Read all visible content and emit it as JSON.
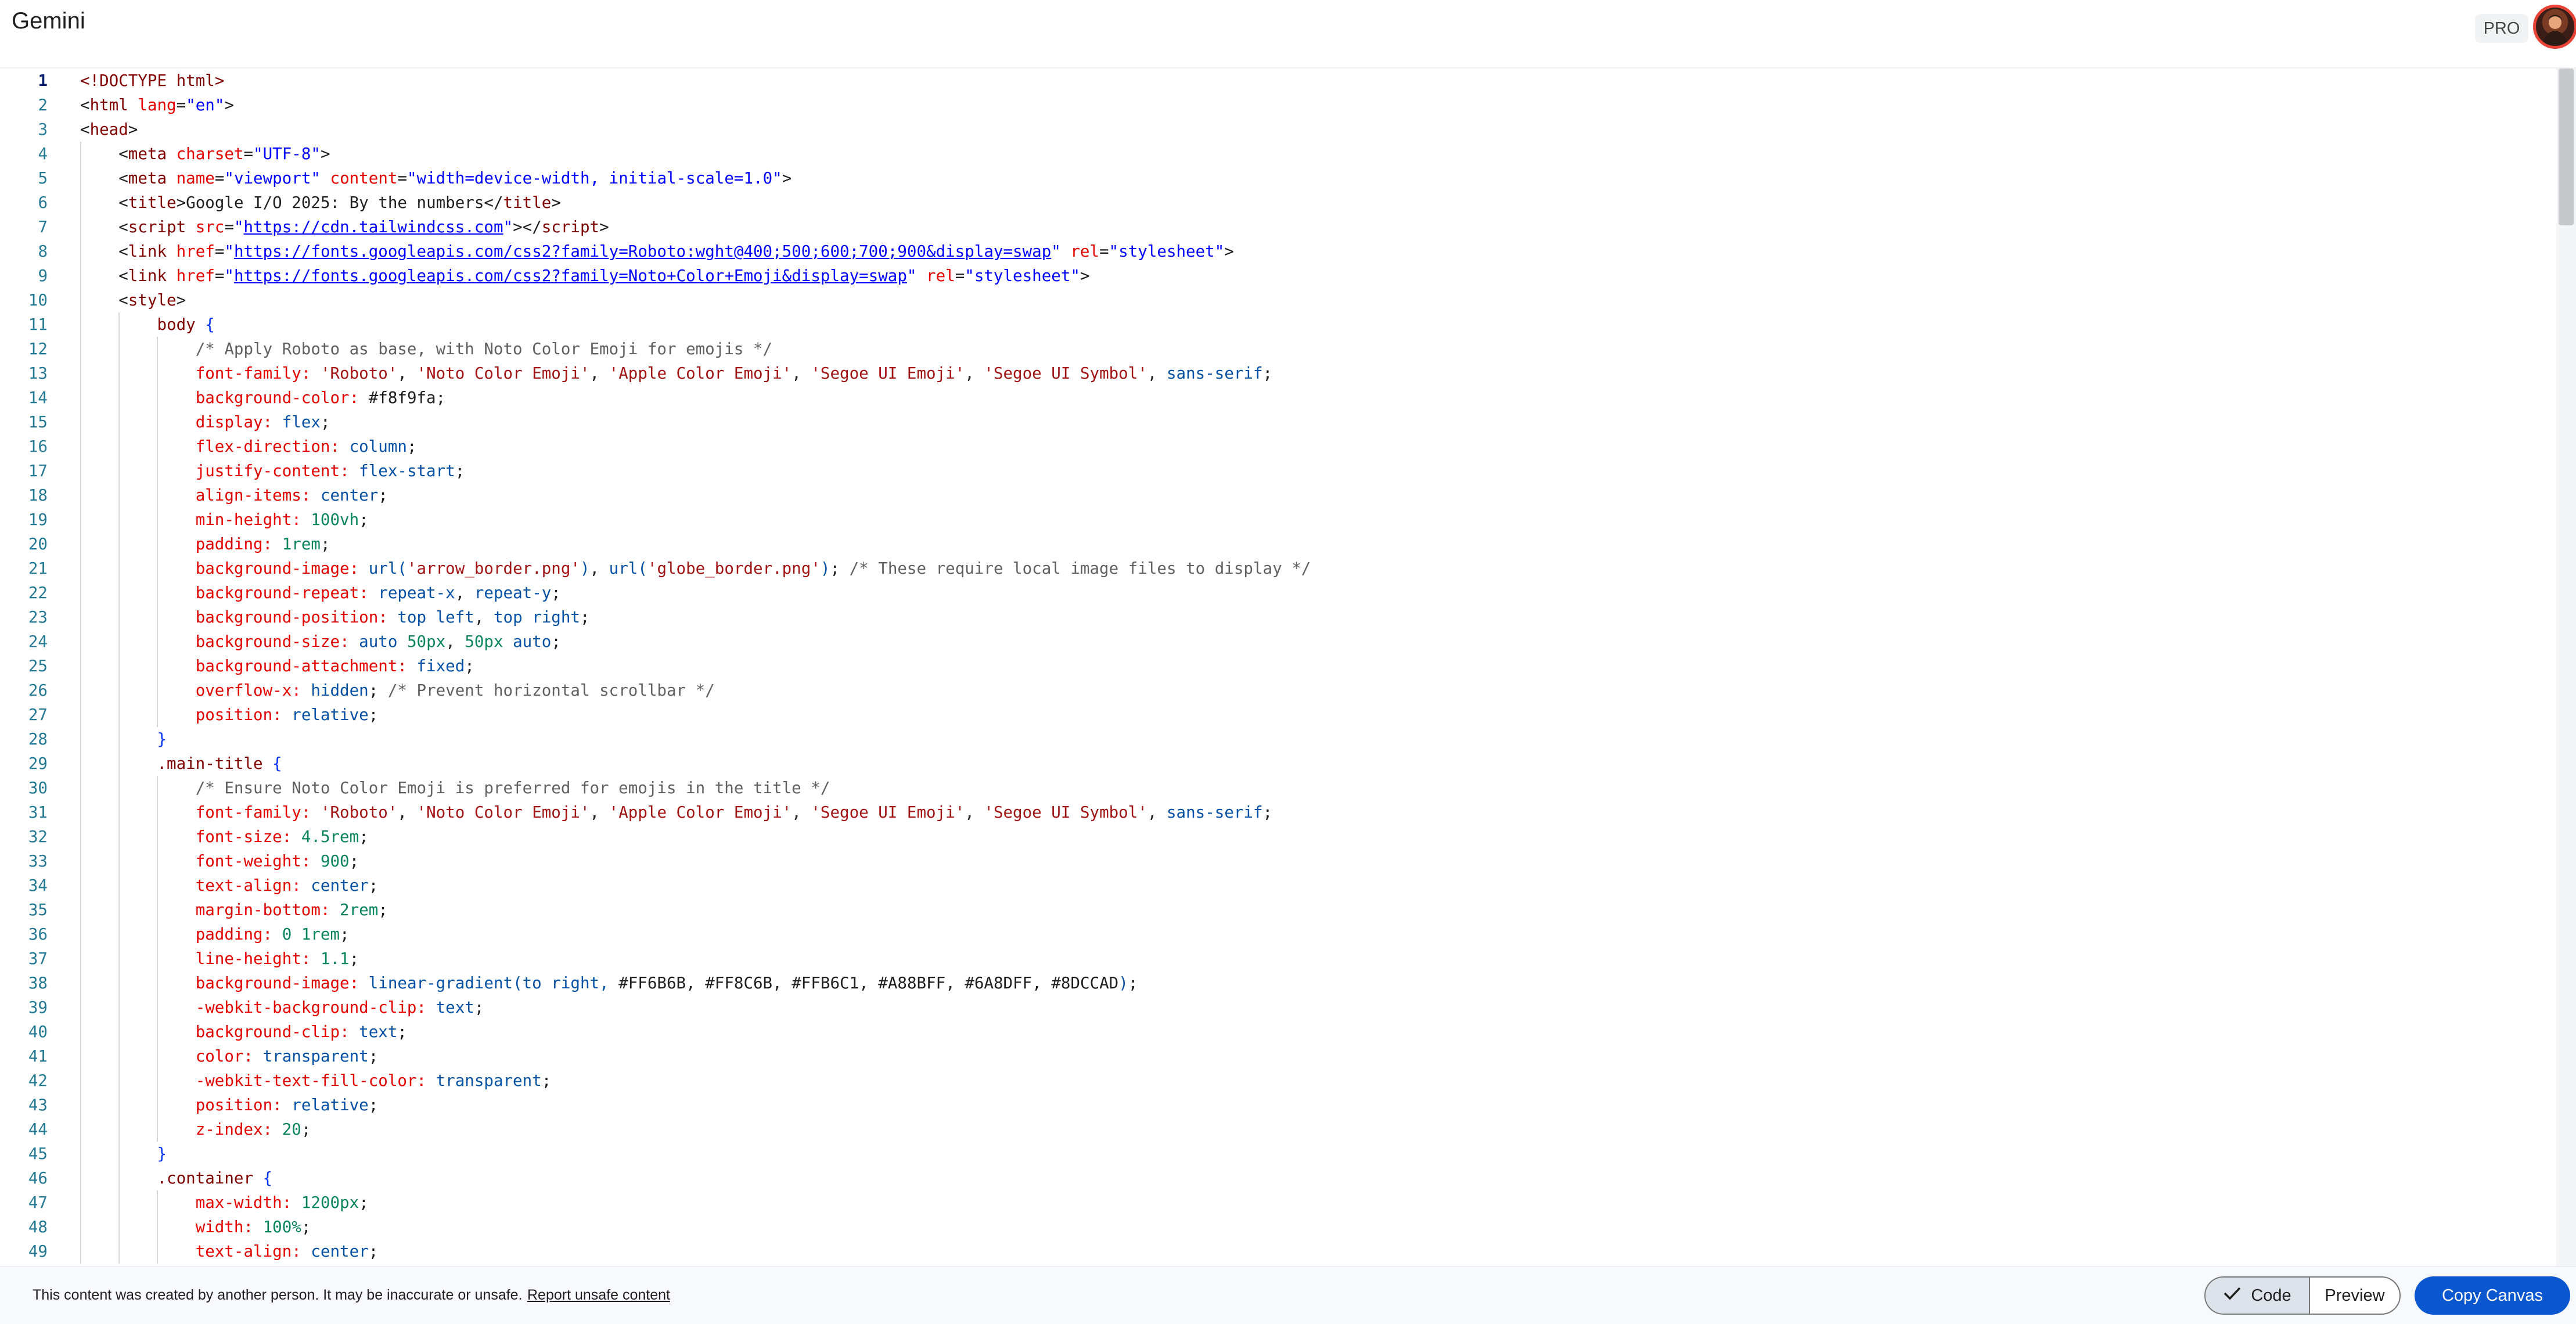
{
  "header": {
    "app_title": "Gemini",
    "pro_badge": "PRO",
    "avatar_alt": "user-avatar"
  },
  "editor": {
    "active_line": 1,
    "lines": [
      [
        [
          "dtd",
          "<!DOCTYPE "
        ],
        [
          "tag",
          "html"
        ],
        [
          "dtd",
          ">"
        ]
      ],
      [
        [
          "punc",
          "<"
        ],
        [
          "tag",
          "html"
        ],
        [
          "plain",
          " "
        ],
        [
          "attr",
          "lang"
        ],
        [
          "punc",
          "="
        ],
        [
          "str",
          "\"en\""
        ],
        [
          "punc",
          ">"
        ]
      ],
      [
        [
          "punc",
          "<"
        ],
        [
          "tag",
          "head"
        ],
        [
          "punc",
          ">"
        ]
      ],
      [
        [
          "plain",
          "    "
        ],
        [
          "punc",
          "<"
        ],
        [
          "tag",
          "meta"
        ],
        [
          "plain",
          " "
        ],
        [
          "attr",
          "charset"
        ],
        [
          "punc",
          "="
        ],
        [
          "str",
          "\"UTF-8\""
        ],
        [
          "punc",
          ">"
        ]
      ],
      [
        [
          "plain",
          "    "
        ],
        [
          "punc",
          "<"
        ],
        [
          "tag",
          "meta"
        ],
        [
          "plain",
          " "
        ],
        [
          "attr",
          "name"
        ],
        [
          "punc",
          "="
        ],
        [
          "str",
          "\"viewport\""
        ],
        [
          "plain",
          " "
        ],
        [
          "attr",
          "content"
        ],
        [
          "punc",
          "="
        ],
        [
          "str",
          "\"width=device-width, initial-scale=1.0\""
        ],
        [
          "punc",
          ">"
        ]
      ],
      [
        [
          "plain",
          "    "
        ],
        [
          "punc",
          "<"
        ],
        [
          "tag",
          "title"
        ],
        [
          "punc",
          ">"
        ],
        [
          "plain",
          "Google I/O 2025: By the numbers"
        ],
        [
          "punc",
          "</"
        ],
        [
          "tag",
          "title"
        ],
        [
          "punc",
          ">"
        ]
      ],
      [
        [
          "plain",
          "    "
        ],
        [
          "punc",
          "<"
        ],
        [
          "tag",
          "script"
        ],
        [
          "plain",
          " "
        ],
        [
          "attr",
          "src"
        ],
        [
          "punc",
          "="
        ],
        [
          "str",
          "\""
        ],
        [
          "link",
          "https://cdn.tailwindcss.com"
        ],
        [
          "str",
          "\""
        ],
        [
          "punc",
          "></"
        ],
        [
          "tag",
          "script"
        ],
        [
          "punc",
          ">"
        ]
      ],
      [
        [
          "plain",
          "    "
        ],
        [
          "punc",
          "<"
        ],
        [
          "tag",
          "link"
        ],
        [
          "plain",
          " "
        ],
        [
          "attr",
          "href"
        ],
        [
          "punc",
          "="
        ],
        [
          "str",
          "\""
        ],
        [
          "link",
          "https://fonts.googleapis.com/css2?family=Roboto:wght@400;500;600;700;900&display=swap"
        ],
        [
          "str",
          "\""
        ],
        [
          "plain",
          " "
        ],
        [
          "attr",
          "rel"
        ],
        [
          "punc",
          "="
        ],
        [
          "str",
          "\"stylesheet\""
        ],
        [
          "punc",
          ">"
        ]
      ],
      [
        [
          "plain",
          "    "
        ],
        [
          "punc",
          "<"
        ],
        [
          "tag",
          "link"
        ],
        [
          "plain",
          " "
        ],
        [
          "attr",
          "href"
        ],
        [
          "punc",
          "="
        ],
        [
          "str",
          "\""
        ],
        [
          "link",
          "https://fonts.googleapis.com/css2?family=Noto+Color+Emoji&display=swap"
        ],
        [
          "str",
          "\""
        ],
        [
          "plain",
          " "
        ],
        [
          "attr",
          "rel"
        ],
        [
          "punc",
          "="
        ],
        [
          "str",
          "\"stylesheet\""
        ],
        [
          "punc",
          ">"
        ]
      ],
      [
        [
          "plain",
          "    "
        ],
        [
          "punc",
          "<"
        ],
        [
          "tag",
          "style"
        ],
        [
          "punc",
          ">"
        ]
      ],
      [
        [
          "plain",
          "        "
        ],
        [
          "sel",
          "body"
        ],
        [
          "plain",
          " "
        ],
        [
          "brace",
          "{"
        ]
      ],
      [
        [
          "plain",
          "            "
        ],
        [
          "cmt",
          "/* Apply Roboto as base, with Noto Color Emoji for emojis */"
        ]
      ],
      [
        [
          "plain",
          "            "
        ],
        [
          "prop",
          "font-family:"
        ],
        [
          "plain",
          " "
        ],
        [
          "cstr",
          "'Roboto'"
        ],
        [
          "plain",
          ", "
        ],
        [
          "cstr",
          "'Noto Color Emoji'"
        ],
        [
          "plain",
          ", "
        ],
        [
          "cstr",
          "'Apple Color Emoji'"
        ],
        [
          "plain",
          ", "
        ],
        [
          "cstr",
          "'Segoe UI Emoji'"
        ],
        [
          "plain",
          ", "
        ],
        [
          "cstr",
          "'Segoe UI Symbol'"
        ],
        [
          "plain",
          ", "
        ],
        [
          "val",
          "sans-serif"
        ],
        [
          "plain",
          ";"
        ]
      ],
      [
        [
          "plain",
          "            "
        ],
        [
          "prop",
          "background-color:"
        ],
        [
          "plain",
          " "
        ],
        [
          "hex",
          "#f8f9fa"
        ],
        [
          "plain",
          ";"
        ]
      ],
      [
        [
          "plain",
          "            "
        ],
        [
          "prop",
          "display:"
        ],
        [
          "plain",
          " "
        ],
        [
          "val",
          "flex"
        ],
        [
          "plain",
          ";"
        ]
      ],
      [
        [
          "plain",
          "            "
        ],
        [
          "prop",
          "flex-direction:"
        ],
        [
          "plain",
          " "
        ],
        [
          "val",
          "column"
        ],
        [
          "plain",
          ";"
        ]
      ],
      [
        [
          "plain",
          "            "
        ],
        [
          "prop",
          "justify-content:"
        ],
        [
          "plain",
          " "
        ],
        [
          "val",
          "flex-start"
        ],
        [
          "plain",
          ";"
        ]
      ],
      [
        [
          "plain",
          "            "
        ],
        [
          "prop",
          "align-items:"
        ],
        [
          "plain",
          " "
        ],
        [
          "val",
          "center"
        ],
        [
          "plain",
          ";"
        ]
      ],
      [
        [
          "plain",
          "            "
        ],
        [
          "prop",
          "min-height:"
        ],
        [
          "plain",
          " "
        ],
        [
          "num",
          "100vh"
        ],
        [
          "plain",
          ";"
        ]
      ],
      [
        [
          "plain",
          "            "
        ],
        [
          "prop",
          "padding:"
        ],
        [
          "plain",
          " "
        ],
        [
          "num",
          "1rem"
        ],
        [
          "plain",
          ";"
        ]
      ],
      [
        [
          "plain",
          "            "
        ],
        [
          "prop",
          "background-image:"
        ],
        [
          "plain",
          " "
        ],
        [
          "val",
          "url("
        ],
        [
          "cstr",
          "'arrow_border.png'"
        ],
        [
          "val",
          ")"
        ],
        [
          "plain",
          ", "
        ],
        [
          "val",
          "url("
        ],
        [
          "cstr",
          "'globe_border.png'"
        ],
        [
          "val",
          ")"
        ],
        [
          "plain",
          "; "
        ],
        [
          "cmt",
          "/* These require local image files to display */"
        ]
      ],
      [
        [
          "plain",
          "            "
        ],
        [
          "prop",
          "background-repeat:"
        ],
        [
          "plain",
          " "
        ],
        [
          "val",
          "repeat-x"
        ],
        [
          "plain",
          ", "
        ],
        [
          "val",
          "repeat-y"
        ],
        [
          "plain",
          ";"
        ]
      ],
      [
        [
          "plain",
          "            "
        ],
        [
          "prop",
          "background-position:"
        ],
        [
          "plain",
          " "
        ],
        [
          "val",
          "top left"
        ],
        [
          "plain",
          ", "
        ],
        [
          "val",
          "top right"
        ],
        [
          "plain",
          ";"
        ]
      ],
      [
        [
          "plain",
          "            "
        ],
        [
          "prop",
          "background-size:"
        ],
        [
          "plain",
          " "
        ],
        [
          "val",
          "auto"
        ],
        [
          "plain",
          " "
        ],
        [
          "num",
          "50px"
        ],
        [
          "plain",
          ", "
        ],
        [
          "num",
          "50px"
        ],
        [
          "plain",
          " "
        ],
        [
          "val",
          "auto"
        ],
        [
          "plain",
          ";"
        ]
      ],
      [
        [
          "plain",
          "            "
        ],
        [
          "prop",
          "background-attachment:"
        ],
        [
          "plain",
          " "
        ],
        [
          "val",
          "fixed"
        ],
        [
          "plain",
          ";"
        ]
      ],
      [
        [
          "plain",
          "            "
        ],
        [
          "prop",
          "overflow-x:"
        ],
        [
          "plain",
          " "
        ],
        [
          "val",
          "hidden"
        ],
        [
          "plain",
          "; "
        ],
        [
          "cmt",
          "/* Prevent horizontal scrollbar */"
        ]
      ],
      [
        [
          "plain",
          "            "
        ],
        [
          "prop",
          "position:"
        ],
        [
          "plain",
          " "
        ],
        [
          "val",
          "relative"
        ],
        [
          "plain",
          ";"
        ]
      ],
      [
        [
          "plain",
          "        "
        ],
        [
          "brace",
          "}"
        ]
      ],
      [
        [
          "plain",
          "        "
        ],
        [
          "sel",
          ".main-title"
        ],
        [
          "plain",
          " "
        ],
        [
          "brace",
          "{"
        ]
      ],
      [
        [
          "plain",
          "            "
        ],
        [
          "cmt",
          "/* Ensure Noto Color Emoji is preferred for emojis in the title */"
        ]
      ],
      [
        [
          "plain",
          "            "
        ],
        [
          "prop",
          "font-family:"
        ],
        [
          "plain",
          " "
        ],
        [
          "cstr",
          "'Roboto'"
        ],
        [
          "plain",
          ", "
        ],
        [
          "cstr",
          "'Noto Color Emoji'"
        ],
        [
          "plain",
          ", "
        ],
        [
          "cstr",
          "'Apple Color Emoji'"
        ],
        [
          "plain",
          ", "
        ],
        [
          "cstr",
          "'Segoe UI Emoji'"
        ],
        [
          "plain",
          ", "
        ],
        [
          "cstr",
          "'Segoe UI Symbol'"
        ],
        [
          "plain",
          ", "
        ],
        [
          "val",
          "sans-serif"
        ],
        [
          "plain",
          ";"
        ]
      ],
      [
        [
          "plain",
          "            "
        ],
        [
          "prop",
          "font-size:"
        ],
        [
          "plain",
          " "
        ],
        [
          "num",
          "4.5rem"
        ],
        [
          "plain",
          ";"
        ]
      ],
      [
        [
          "plain",
          "            "
        ],
        [
          "prop",
          "font-weight:"
        ],
        [
          "plain",
          " "
        ],
        [
          "num",
          "900"
        ],
        [
          "plain",
          ";"
        ]
      ],
      [
        [
          "plain",
          "            "
        ],
        [
          "prop",
          "text-align:"
        ],
        [
          "plain",
          " "
        ],
        [
          "val",
          "center"
        ],
        [
          "plain",
          ";"
        ]
      ],
      [
        [
          "plain",
          "            "
        ],
        [
          "prop",
          "margin-bottom:"
        ],
        [
          "plain",
          " "
        ],
        [
          "num",
          "2rem"
        ],
        [
          "plain",
          ";"
        ]
      ],
      [
        [
          "plain",
          "            "
        ],
        [
          "prop",
          "padding:"
        ],
        [
          "plain",
          " "
        ],
        [
          "num",
          "0 1rem"
        ],
        [
          "plain",
          ";"
        ]
      ],
      [
        [
          "plain",
          "            "
        ],
        [
          "prop",
          "line-height:"
        ],
        [
          "plain",
          " "
        ],
        [
          "num",
          "1.1"
        ],
        [
          "plain",
          ";"
        ]
      ],
      [
        [
          "plain",
          "            "
        ],
        [
          "prop",
          "background-image:"
        ],
        [
          "plain",
          " "
        ],
        [
          "val",
          "linear-gradient(to right, "
        ],
        [
          "hex",
          "#FF6B6B"
        ],
        [
          "plain",
          ", "
        ],
        [
          "hex",
          "#FF8C6B"
        ],
        [
          "plain",
          ", "
        ],
        [
          "hex",
          "#FFB6C1"
        ],
        [
          "plain",
          ", "
        ],
        [
          "hex",
          "#A88BFF"
        ],
        [
          "plain",
          ", "
        ],
        [
          "hex",
          "#6A8DFF"
        ],
        [
          "plain",
          ", "
        ],
        [
          "hex",
          "#8DCCAD"
        ],
        [
          "val",
          ")"
        ],
        [
          "plain",
          ";"
        ]
      ],
      [
        [
          "plain",
          "            "
        ],
        [
          "prop",
          "-webkit-background-clip:"
        ],
        [
          "plain",
          " "
        ],
        [
          "val",
          "text"
        ],
        [
          "plain",
          ";"
        ]
      ],
      [
        [
          "plain",
          "            "
        ],
        [
          "prop",
          "background-clip:"
        ],
        [
          "plain",
          " "
        ],
        [
          "val",
          "text"
        ],
        [
          "plain",
          ";"
        ]
      ],
      [
        [
          "plain",
          "            "
        ],
        [
          "prop",
          "color:"
        ],
        [
          "plain",
          " "
        ],
        [
          "val",
          "transparent"
        ],
        [
          "plain",
          ";"
        ]
      ],
      [
        [
          "plain",
          "            "
        ],
        [
          "prop",
          "-webkit-text-fill-color:"
        ],
        [
          "plain",
          " "
        ],
        [
          "val",
          "transparent"
        ],
        [
          "plain",
          ";"
        ]
      ],
      [
        [
          "plain",
          "            "
        ],
        [
          "prop",
          "position:"
        ],
        [
          "plain",
          " "
        ],
        [
          "val",
          "relative"
        ],
        [
          "plain",
          ";"
        ]
      ],
      [
        [
          "plain",
          "            "
        ],
        [
          "prop",
          "z-index:"
        ],
        [
          "plain",
          " "
        ],
        [
          "num",
          "20"
        ],
        [
          "plain",
          ";"
        ]
      ],
      [
        [
          "plain",
          "        "
        ],
        [
          "brace",
          "}"
        ]
      ],
      [
        [
          "plain",
          "        "
        ],
        [
          "sel",
          ".container"
        ],
        [
          "plain",
          " "
        ],
        [
          "brace",
          "{"
        ]
      ],
      [
        [
          "plain",
          "            "
        ],
        [
          "prop",
          "max-width:"
        ],
        [
          "plain",
          " "
        ],
        [
          "num",
          "1200px"
        ],
        [
          "plain",
          ";"
        ]
      ],
      [
        [
          "plain",
          "            "
        ],
        [
          "prop",
          "width:"
        ],
        [
          "plain",
          " "
        ],
        [
          "num",
          "100%"
        ],
        [
          "plain",
          ";"
        ]
      ],
      [
        [
          "plain",
          "            "
        ],
        [
          "prop",
          "text-align:"
        ],
        [
          "plain",
          " "
        ],
        [
          "val",
          "center"
        ],
        [
          "plain",
          ";"
        ]
      ]
    ]
  },
  "footer": {
    "disclaimer": "This content was created by another person. It may be inaccurate or unsafe.",
    "report_link": "Report unsafe content",
    "toggle_code": "Code",
    "toggle_preview": "Preview",
    "copy_button": "Copy Canvas",
    "accent_color": "#0b57d0"
  }
}
